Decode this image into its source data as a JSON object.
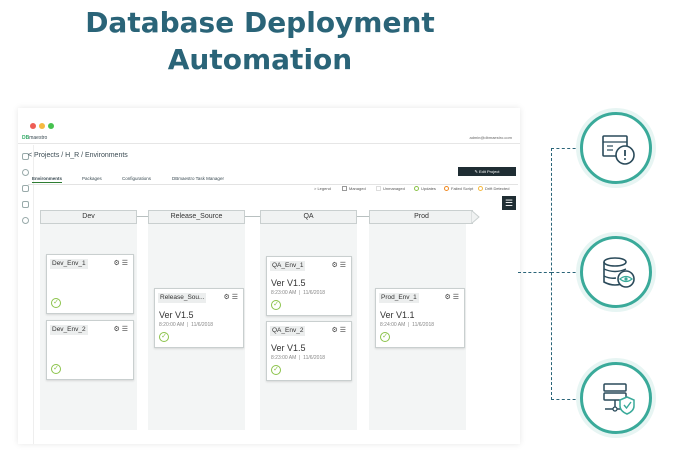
{
  "headline": {
    "line1": "Database Deployment",
    "line2": "Automation"
  },
  "window": {
    "dot_colors": [
      "#ee5d55",
      "#f5b940",
      "#46c24f"
    ],
    "logo": {
      "brand": "DB",
      "rest": "maestro"
    },
    "user": "admin@dbmaestro.com",
    "breadcrumb": "< Projects / H_R / Environments",
    "edit_button": "✎ Edit Project",
    "tabs": [
      "Environments",
      "Packages",
      "Configurations",
      "DBmaestro Task Manager"
    ],
    "legend": {
      "label": "> Legend",
      "items": [
        "Managed",
        "Unmanaged",
        "Updates",
        "Failed Script",
        "Drift Detected"
      ]
    },
    "menu_icon": "hamburger-icon",
    "stages": [
      "Dev",
      "Release_Source",
      "QA",
      "Prod"
    ],
    "cards": [
      {
        "title": "Dev_Env_1",
        "version": "",
        "time": "",
        "date": ""
      },
      {
        "title": "Dev_Env_2",
        "version": "",
        "time": "",
        "date": ""
      },
      {
        "title": "Release_Sou...",
        "version": "Ver V1.5",
        "time": "8:20:00 AM",
        "date": "11/6/2018"
      },
      {
        "title": "QA_Env_1",
        "version": "Ver V1.5",
        "time": "8:23:00 AM",
        "date": "11/6/2018"
      },
      {
        "title": "QA_Env_2",
        "version": "Ver V1.5",
        "time": "8:23:00 AM",
        "date": "11/6/2018"
      },
      {
        "title": "Prod_Env_1",
        "version": "Ver V1.1",
        "time": "8:24:00 AM",
        "date": "11/6/2018"
      }
    ],
    "card_controls": "⚙ ☰",
    "check_glyph": "✓"
  },
  "feature_icons": [
    "warning-icon",
    "database-eye-icon",
    "server-shield-icon"
  ],
  "colors": {
    "headline": "#2a6478",
    "teal": "#3aaa9a",
    "check": "#8bc34a"
  }
}
